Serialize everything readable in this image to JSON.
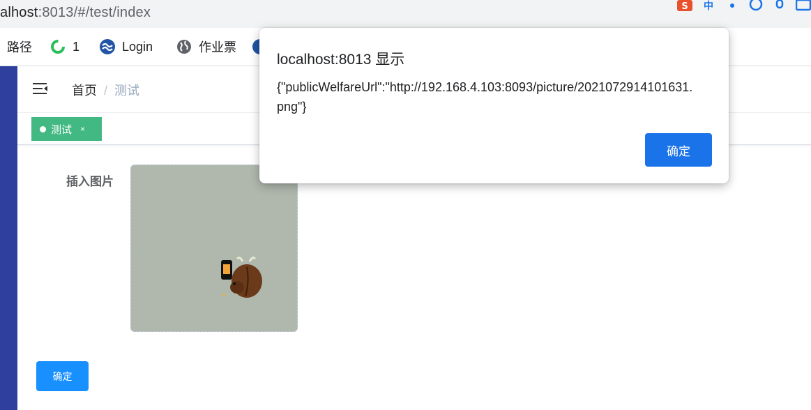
{
  "browser": {
    "url_host": "alhost",
    "url_rest": ":8013/#/test/index"
  },
  "bookmarks": [
    {
      "label": "路径",
      "icon": "none"
    },
    {
      "label": "1",
      "icon": "green-ring-icon"
    },
    {
      "label": "Login",
      "icon": "blue-wave-logo-icon"
    },
    {
      "label": "作业票",
      "icon": "globe-icon"
    }
  ],
  "navbar": {
    "breadcrumb_home": "首页",
    "breadcrumb_sep": "/",
    "breadcrumb_current": "测试"
  },
  "tags": {
    "active_label": "测试",
    "close_glyph": "×"
  },
  "form": {
    "image_label": "插入图片",
    "submit_label": "确定"
  },
  "dialog": {
    "title": "localhost:8013 显示",
    "message": "{\"publicWelfareUrl\":\"http://192.168.4.103:8093/picture/2021072914101631.png\"}",
    "ok_label": "确定"
  },
  "colors": {
    "sidebar": "#2f3f9e",
    "tag_active": "#42b983",
    "primary_button": "#1890ff",
    "dialog_button": "#1a73e8"
  }
}
